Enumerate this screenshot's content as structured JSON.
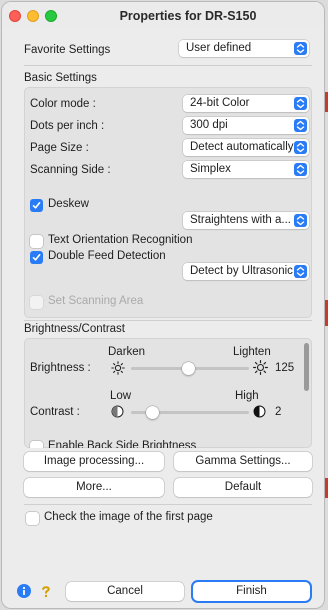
{
  "window": {
    "title": "Properties for DR-S150"
  },
  "favorite": {
    "label": "Favorite Settings",
    "value": "User defined"
  },
  "basic": {
    "section_title": "Basic Settings",
    "color_mode": {
      "label": "Color mode :",
      "value": "24-bit Color"
    },
    "dpi": {
      "label": "Dots per inch :",
      "value": "300 dpi"
    },
    "page_size": {
      "label": "Page Size :",
      "value": "Detect automatically"
    },
    "scanning_side": {
      "label": "Scanning Side :",
      "value": "Simplex"
    },
    "deskew": {
      "label": "Deskew",
      "checked": true,
      "option": "Straightens with a..."
    },
    "text_orientation": {
      "label": "Text Orientation Recognition",
      "checked": false
    },
    "double_feed": {
      "label": "Double Feed Detection",
      "checked": true,
      "option": "Detect by Ultrasonic"
    },
    "scan_area": {
      "label": "Set Scanning Area",
      "checked": false,
      "disabled": true
    }
  },
  "brightness_contrast": {
    "section_title": "Brightness/Contrast",
    "brightness": {
      "label": "Brightness :",
      "low": "Darken",
      "high": "Lighten",
      "value": "125",
      "level": 0.49
    },
    "contrast": {
      "label": "Contrast :",
      "low": "Low",
      "high": "High",
      "value": "2",
      "level": 0.18
    },
    "back_side": {
      "label": "Enable Back Side Brightness"
    }
  },
  "buttons": {
    "image_processing": "Image processing...",
    "gamma": "Gamma Settings...",
    "more": "More...",
    "default": "Default",
    "cancel": "Cancel",
    "finish": "Finish"
  },
  "first_page_check": {
    "label": "Check the image of the first page",
    "checked": false
  },
  "colors": {
    "accent": "#2a7cf6"
  }
}
